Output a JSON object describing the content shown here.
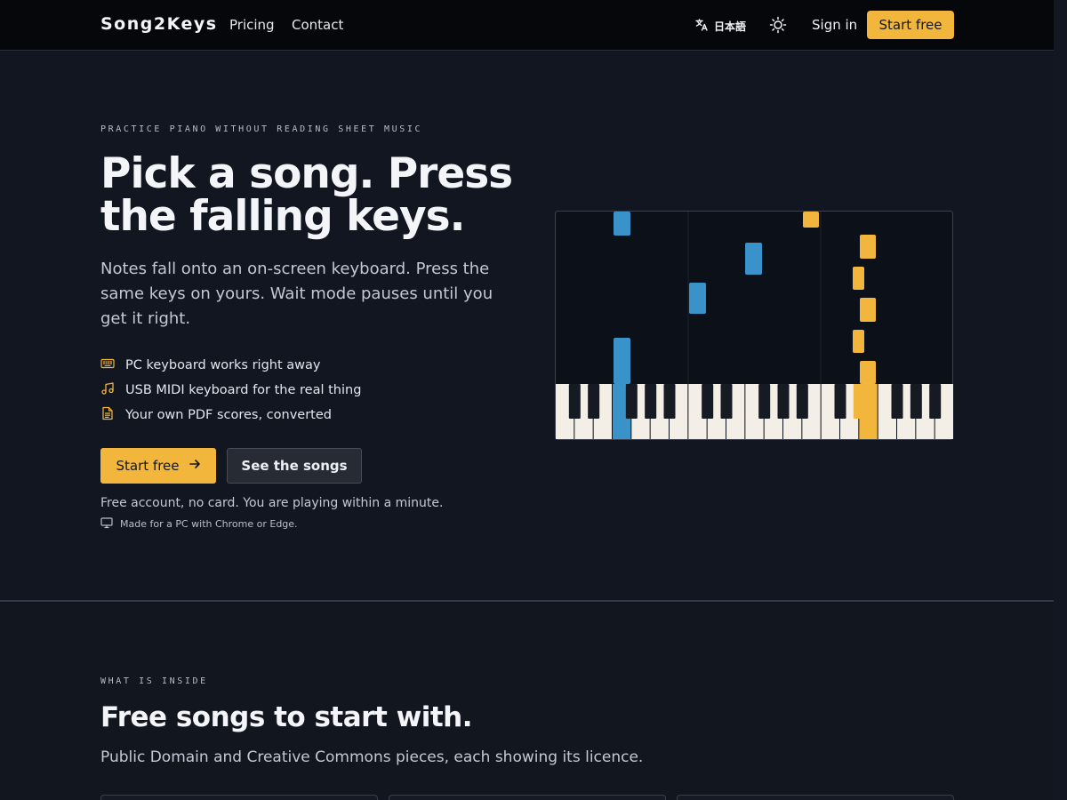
{
  "header": {
    "brand": "Song2Keys",
    "nav": [
      {
        "label": "Pricing"
      },
      {
        "label": "Contact"
      }
    ],
    "language": {
      "label": "日本語",
      "icon": "translate-icon"
    },
    "theme_icon": "sun-icon",
    "signin_label": "Sign in",
    "start_label": "Start free"
  },
  "hero": {
    "eyebrow": "PRACTICE PIANO WITHOUT READING SHEET MUSIC",
    "title": "Pick a song. Press the falling keys.",
    "subtitle": "Notes fall onto an on-screen keyboard. Press the same keys on yours. Wait mode pauses until you get it right.",
    "features": [
      {
        "icon": "keyboard-icon",
        "label": "PC keyboard works right away"
      },
      {
        "icon": "music-note-icon",
        "label": "USB MIDI keyboard for the real thing"
      },
      {
        "icon": "document-icon",
        "label": "Your own PDF scores, converted"
      }
    ],
    "primary_cta": "Start free",
    "secondary_cta": "See the songs",
    "fine_print": "Free account, no card. You are playing within a minute.",
    "platform_note": "Made for a PC with Chrome or Edge.",
    "platform_icon": "monitor-icon"
  },
  "colors": {
    "accent": "#f2b63d",
    "blue_note": "#3a93c8"
  },
  "section2": {
    "eyebrow": "WHAT IS INSIDE",
    "title": "Free songs to start with.",
    "subtitle": "Public Domain and Creative Commons pieces, each showing its licence."
  }
}
